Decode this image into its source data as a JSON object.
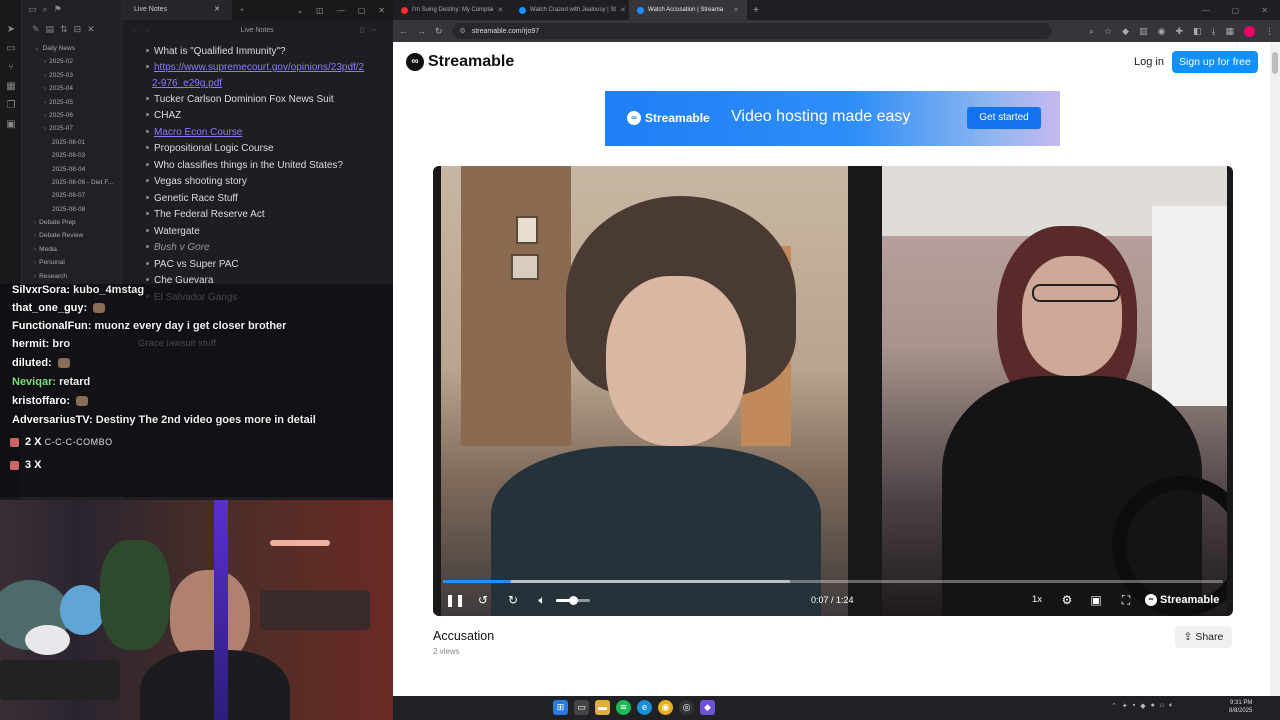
{
  "notes": {
    "tab_title": "Live Notes",
    "header_title": "Live Notes",
    "ribbon_icons": [
      "send-icon",
      "folder-icon",
      "git-branch-icon",
      "grid-icon",
      "copy-icon",
      "terminal-icon"
    ],
    "tree": [
      {
        "label": "Daily News",
        "level": 0,
        "open": true
      },
      {
        "label": "2025-02",
        "level": 1
      },
      {
        "label": "2025-03",
        "level": 1
      },
      {
        "label": "2025-04",
        "level": 1
      },
      {
        "label": "2025-05",
        "level": 1
      },
      {
        "label": "2025-06",
        "level": 1
      },
      {
        "label": "2025-07",
        "level": 1
      },
      {
        "label": "2025-08-01",
        "level": 2
      },
      {
        "label": "2025-08-03",
        "level": 2
      },
      {
        "label": "2025-08-04",
        "level": 2
      },
      {
        "label": "2025-08-06 - Diet F...",
        "level": 2
      },
      {
        "label": "2025-08-07",
        "level": 2
      },
      {
        "label": "2025-08-08",
        "level": 2
      },
      {
        "label": "Debate Prep",
        "level": 0
      },
      {
        "label": "Debate Review",
        "level": 0
      },
      {
        "label": "Media",
        "level": 0
      },
      {
        "label": "Personal",
        "level": 0
      },
      {
        "label": "Research",
        "level": 0
      }
    ],
    "lines": [
      {
        "text": "What is \"Qualified Immunity\"?",
        "style": "normal"
      },
      {
        "text": "https://www.supremecourt.gov/opinions/23pdf/2",
        "style": "link"
      },
      {
        "text": "2-976_e29g.pdf",
        "style": "link-cont"
      },
      {
        "text": "Tucker Carlson Dominion Fox News Suit",
        "style": "normal"
      },
      {
        "text": "CHAZ",
        "style": "normal"
      },
      {
        "text": "Macro Econ Course",
        "style": "link"
      },
      {
        "text": "Propositional Logic Course",
        "style": "normal"
      },
      {
        "text": "Who classifies things in the United States?",
        "style": "normal"
      },
      {
        "text": "Vegas shooting story",
        "style": "normal"
      },
      {
        "text": "Genetic Race Stuff",
        "style": "normal"
      },
      {
        "text": "The Federal Reserve Act",
        "style": "normal"
      },
      {
        "text": "Watergate",
        "style": "normal"
      },
      {
        "text": "Bush v Gore",
        "style": "italic"
      },
      {
        "text": "PAC vs Super PAC",
        "style": "normal"
      },
      {
        "text": "Che Guevara",
        "style": "normal"
      },
      {
        "text": "El Salvador Gangs",
        "style": "normal"
      }
    ],
    "extra_line": "Grace lawsuit stuff"
  },
  "chat": {
    "messages": [
      {
        "user": "SilvxrSora:",
        "text": "kubo_4mstag",
        "user_color": "#ffffff"
      },
      {
        "user": "that_one_guy:",
        "text": "",
        "user_color": "#ffffff"
      },
      {
        "user": "FunctionalFun:",
        "text": "muonz every day i get closer brother",
        "user_color": "#ffffff"
      },
      {
        "user": "hermit:",
        "text": "bro",
        "user_color": "#ffffff"
      },
      {
        "user": "diluted:",
        "text": "",
        "user_color": "#ffffff"
      },
      {
        "user": "Neviqar:",
        "text": "retard",
        "user_color": "#7fe07f"
      },
      {
        "user": "kristoffaro:",
        "text": "",
        "user_color": "#ffffff"
      },
      {
        "user": "AdversariusTV:",
        "text": "Destiny The 2nd video goes more in detail",
        "user_color": "#ffffff"
      }
    ],
    "combos": [
      {
        "count": "2 X",
        "label": "C-C-C-COMBO"
      },
      {
        "count": "3 X",
        "label": ""
      }
    ]
  },
  "browser": {
    "tabs": [
      {
        "title": "I'm Suing Destiny: My Complai",
        "favicon_color": "#ff2b2b",
        "active": false
      },
      {
        "title": "Watch Crazed with Jealousy | St",
        "favicon_color": "#1e90ff",
        "active": false
      },
      {
        "title": "Watch Accusation | Streama",
        "favicon_color": "#1e90ff",
        "active": true
      }
    ],
    "url": "streamable.com/rjo97"
  },
  "page": {
    "brand": "Streamable",
    "login": "Log in",
    "signup": "Sign up for free",
    "banner": {
      "brand": "Streamable",
      "tagline": "Video hosting made easy",
      "button": "Get started"
    },
    "player": {
      "progress": 0.087,
      "buffered": 0.445,
      "volume": 0.5,
      "time": "0:07 / 1:24",
      "speed": "1x",
      "brand": "Streamable"
    },
    "video_title": "Accusation",
    "views": "2 views",
    "share": "Share"
  },
  "taskbar": {
    "time": "9:31 PM",
    "date": "8/8/2025"
  }
}
